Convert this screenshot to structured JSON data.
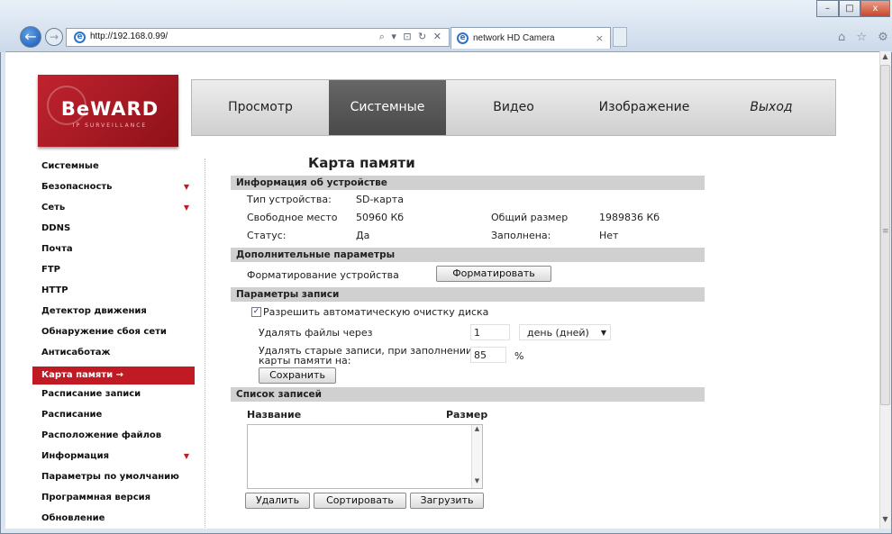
{
  "browser": {
    "address": "http://192.168.0.99/",
    "address_tools": "⌕ ▾ ⊡ ↻ ✕",
    "tab_title": "network HD Camera",
    "tab_close": "×",
    "back_glyph": "←",
    "fwd_glyph": "→",
    "right_icons": "⌂ ☆ ⚙",
    "win_min": "–",
    "win_max": "□",
    "win_close": "x"
  },
  "logo": {
    "brand": "BeWARD",
    "subtitle": "IP SURVEILLANCE"
  },
  "menu": [
    {
      "label": "Просмотр"
    },
    {
      "label": "Системные"
    },
    {
      "label": "Видео"
    },
    {
      "label": "Изображение"
    },
    {
      "label": "Выход"
    }
  ],
  "sidebar": {
    "items": [
      {
        "label": "Системные",
        "arrow": ""
      },
      {
        "label": "Безопасность",
        "arrow": "▼"
      },
      {
        "label": "Сеть",
        "arrow": "▼"
      },
      {
        "label": "DDNS",
        "arrow": ""
      },
      {
        "label": "Почта",
        "arrow": ""
      },
      {
        "label": "FTP",
        "arrow": ""
      },
      {
        "label": "HTTP",
        "arrow": ""
      },
      {
        "label": "Детектор движения",
        "arrow": ""
      },
      {
        "label": "Обнаружение сбоя сети",
        "arrow": ""
      },
      {
        "label": "Антисаботаж",
        "arrow": ""
      },
      {
        "label": "Карта памяти →",
        "arrow": ""
      },
      {
        "label": "Расписание записи",
        "arrow": ""
      },
      {
        "label": "Расписание",
        "arrow": ""
      },
      {
        "label": "Расположение файлов",
        "arrow": ""
      },
      {
        "label": "Информация",
        "arrow": "▼"
      },
      {
        "label": "Параметры по умолчанию",
        "arrow": ""
      },
      {
        "label": "Программная версия",
        "arrow": ""
      },
      {
        "label": "Обновление",
        "arrow": ""
      }
    ],
    "active_index": 10
  },
  "page": {
    "title": "Карта памяти"
  },
  "device_info": {
    "header": "Информация об устройстве",
    "type_label": "Тип устройства:",
    "type_value": "SD-карта",
    "free_label": "Свободное место",
    "free_value": "50960 Кб",
    "total_label": "Общий размер",
    "total_value": "1989836 Кб",
    "status_label": "Статус:",
    "status_value": "Да",
    "full_label": "Заполнена:",
    "full_value": "Нет"
  },
  "extra": {
    "header": "Дополнительные параметры",
    "format_label": "Форматирование устройства",
    "format_button": "Форматировать"
  },
  "record": {
    "header": "Параметры записи",
    "autoclean_label": "Разрешить автоматическую очистку диска",
    "autoclean_checked": true,
    "delete_label": "Удалять файлы через",
    "delete_value": "1",
    "delete_unit": "день (дней)",
    "old_label_1": "Удалять старые записи, при заполнении",
    "old_label_2": "карты памяти на:",
    "old_value": "85",
    "old_unit": "%",
    "save_button": "Сохранить"
  },
  "list": {
    "header": "Список записей",
    "col_name": "Название",
    "col_size": "Размер",
    "delete_button": "Удалить",
    "sort_button": "Сортировать",
    "download_button": "Загрузить"
  }
}
